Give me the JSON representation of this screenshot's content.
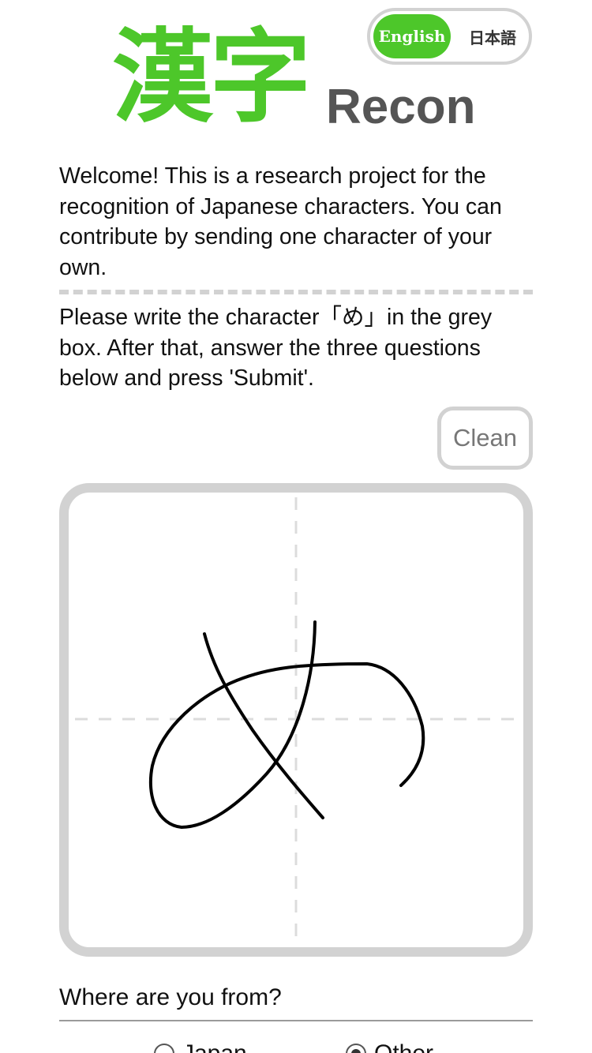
{
  "language": {
    "options": [
      "English",
      "日本語"
    ],
    "selected": "English"
  },
  "logo": {
    "kanji": "漢字",
    "word": "Recon"
  },
  "intro": {
    "welcome": "Welcome! This is a research project for the recognition of Japanese characters. You can contribute by sending one character of your own.",
    "instructions": "Please write the character「め」in the grey box. After that, answer the three questions below and press 'Submit'."
  },
  "canvas": {
    "clean_label": "Clean",
    "target_character": "め"
  },
  "question1": {
    "label": "Where are you from?",
    "options": [
      {
        "label": "Japan",
        "selected": false
      },
      {
        "label": "Other",
        "selected": true
      }
    ]
  },
  "colors": {
    "accent": "#4dc72a",
    "border": "#d2d2d2",
    "logo_text": "#555555"
  }
}
